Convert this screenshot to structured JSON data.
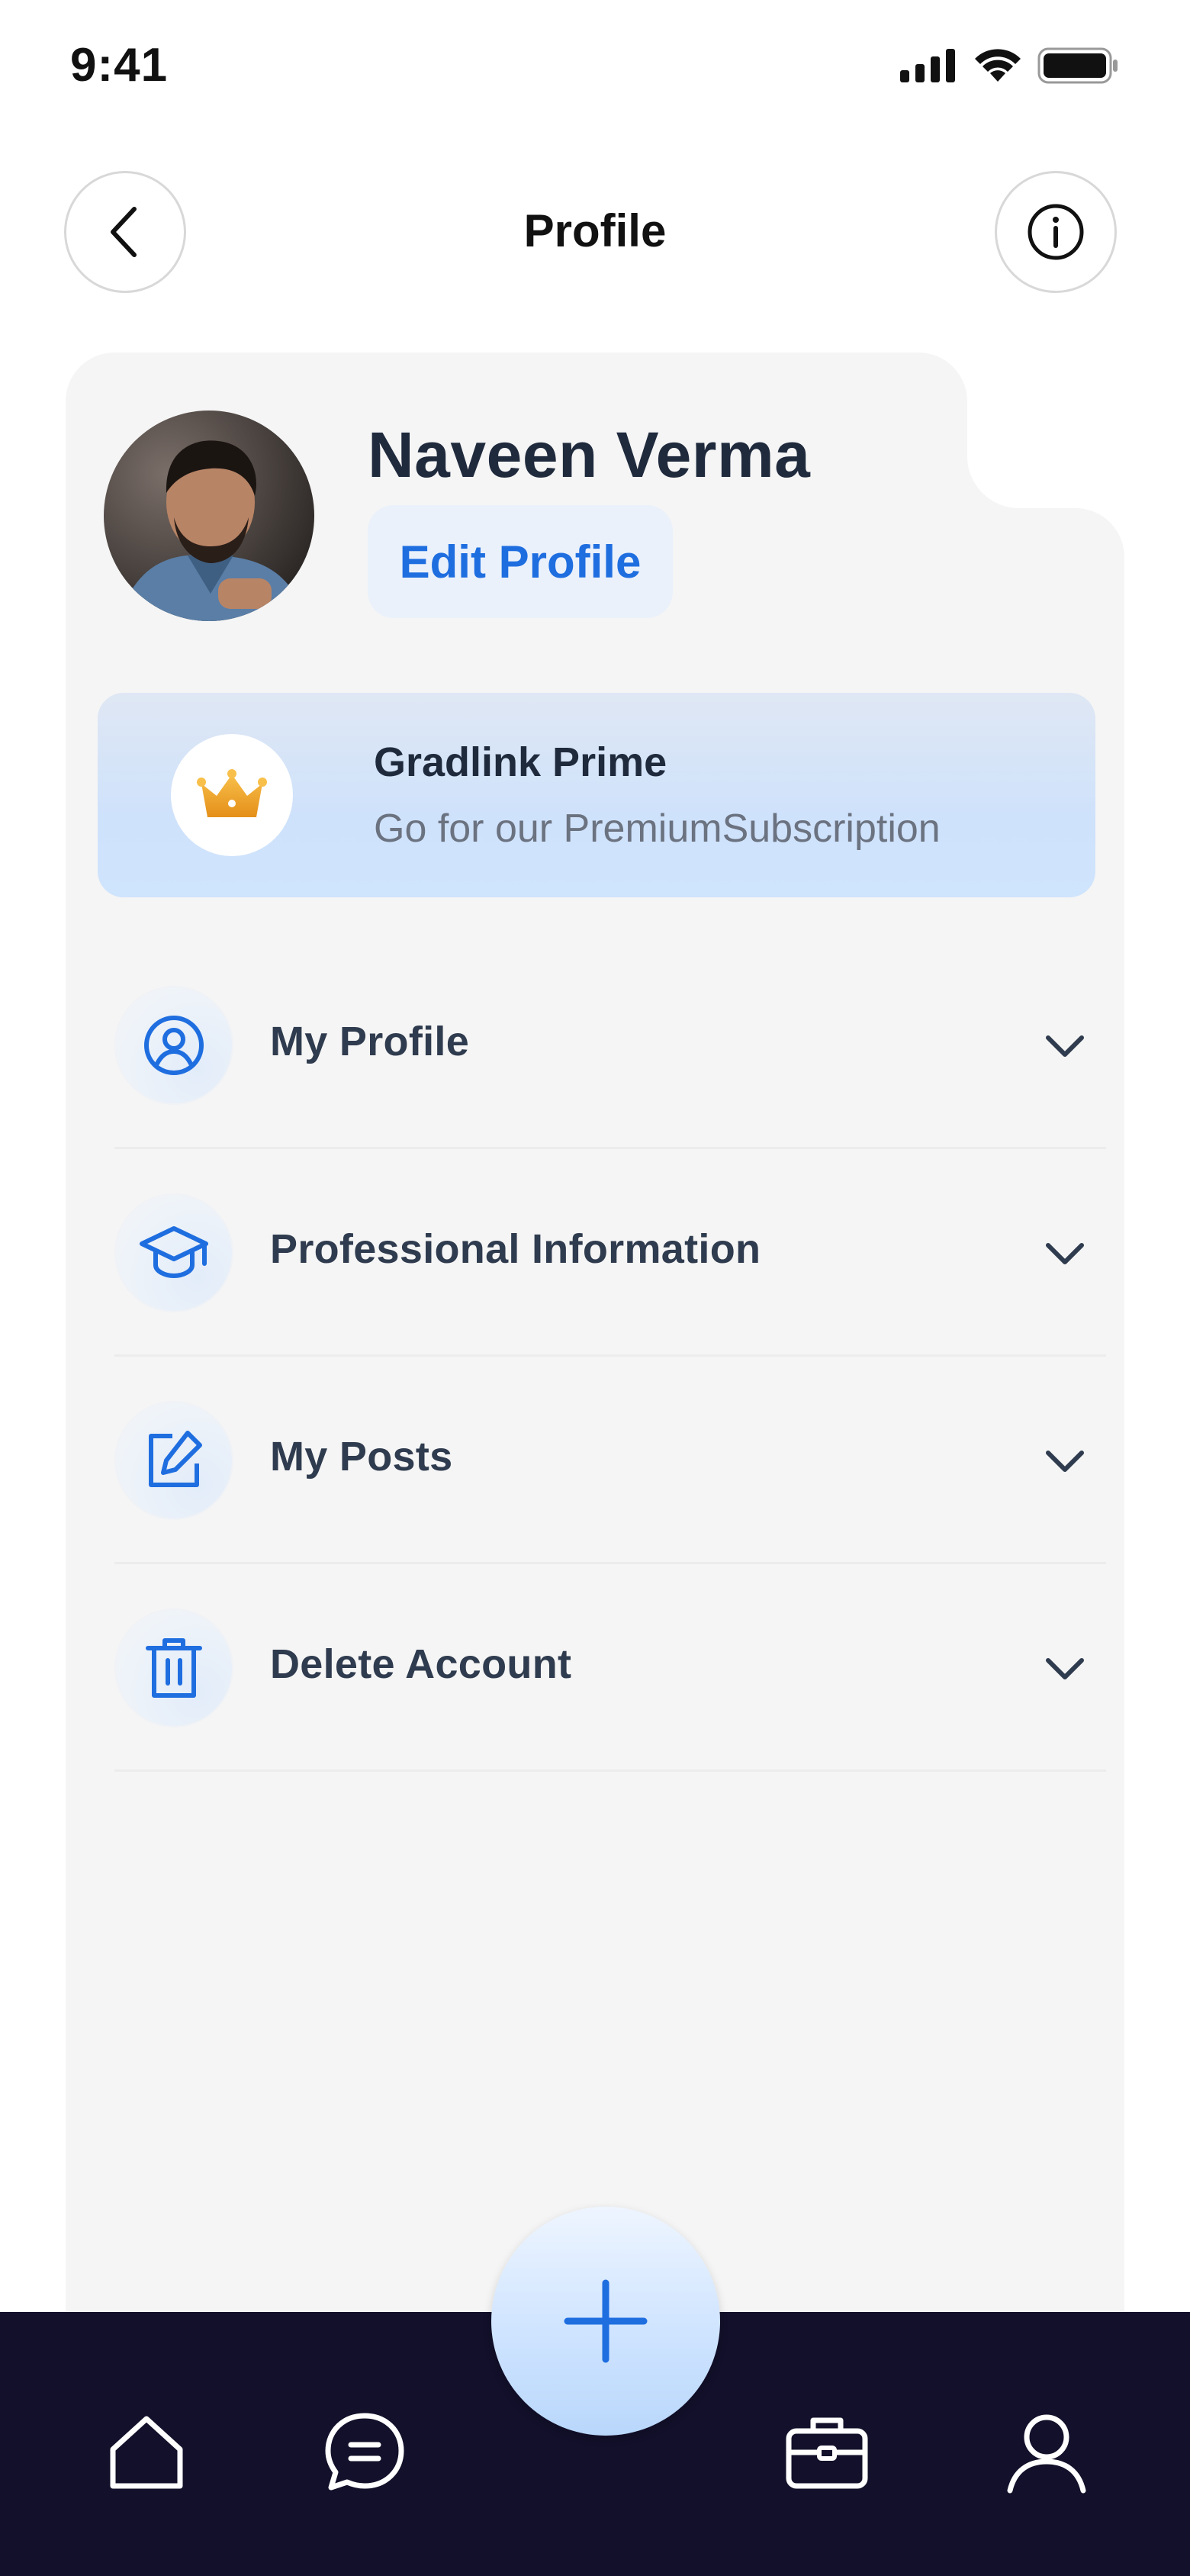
{
  "status_bar": {
    "time": "9:41"
  },
  "header": {
    "title": "Profile"
  },
  "profile": {
    "name": "Naveen Verma",
    "edit_label": "Edit Profile"
  },
  "prime": {
    "title": "Gradlink Prime",
    "subtitle": "Go for our PremiumSubscription"
  },
  "menu": {
    "items": [
      {
        "label": "My Profile",
        "icon": "user-circle-icon"
      },
      {
        "label": "Professional Information",
        "icon": "graduation-cap-icon"
      },
      {
        "label": "My Posts",
        "icon": "edit-post-icon"
      },
      {
        "label": "Delete Account",
        "icon": "trash-icon"
      }
    ]
  },
  "bottom_nav": {
    "items": [
      "home-icon",
      "chat-icon",
      "add-icon",
      "briefcase-icon",
      "user-icon"
    ]
  },
  "colors": {
    "accent": "#1f6ee0",
    "nav_background": "#12102a",
    "card_background": "#f5f5f5",
    "crown": "#f0a52a"
  }
}
